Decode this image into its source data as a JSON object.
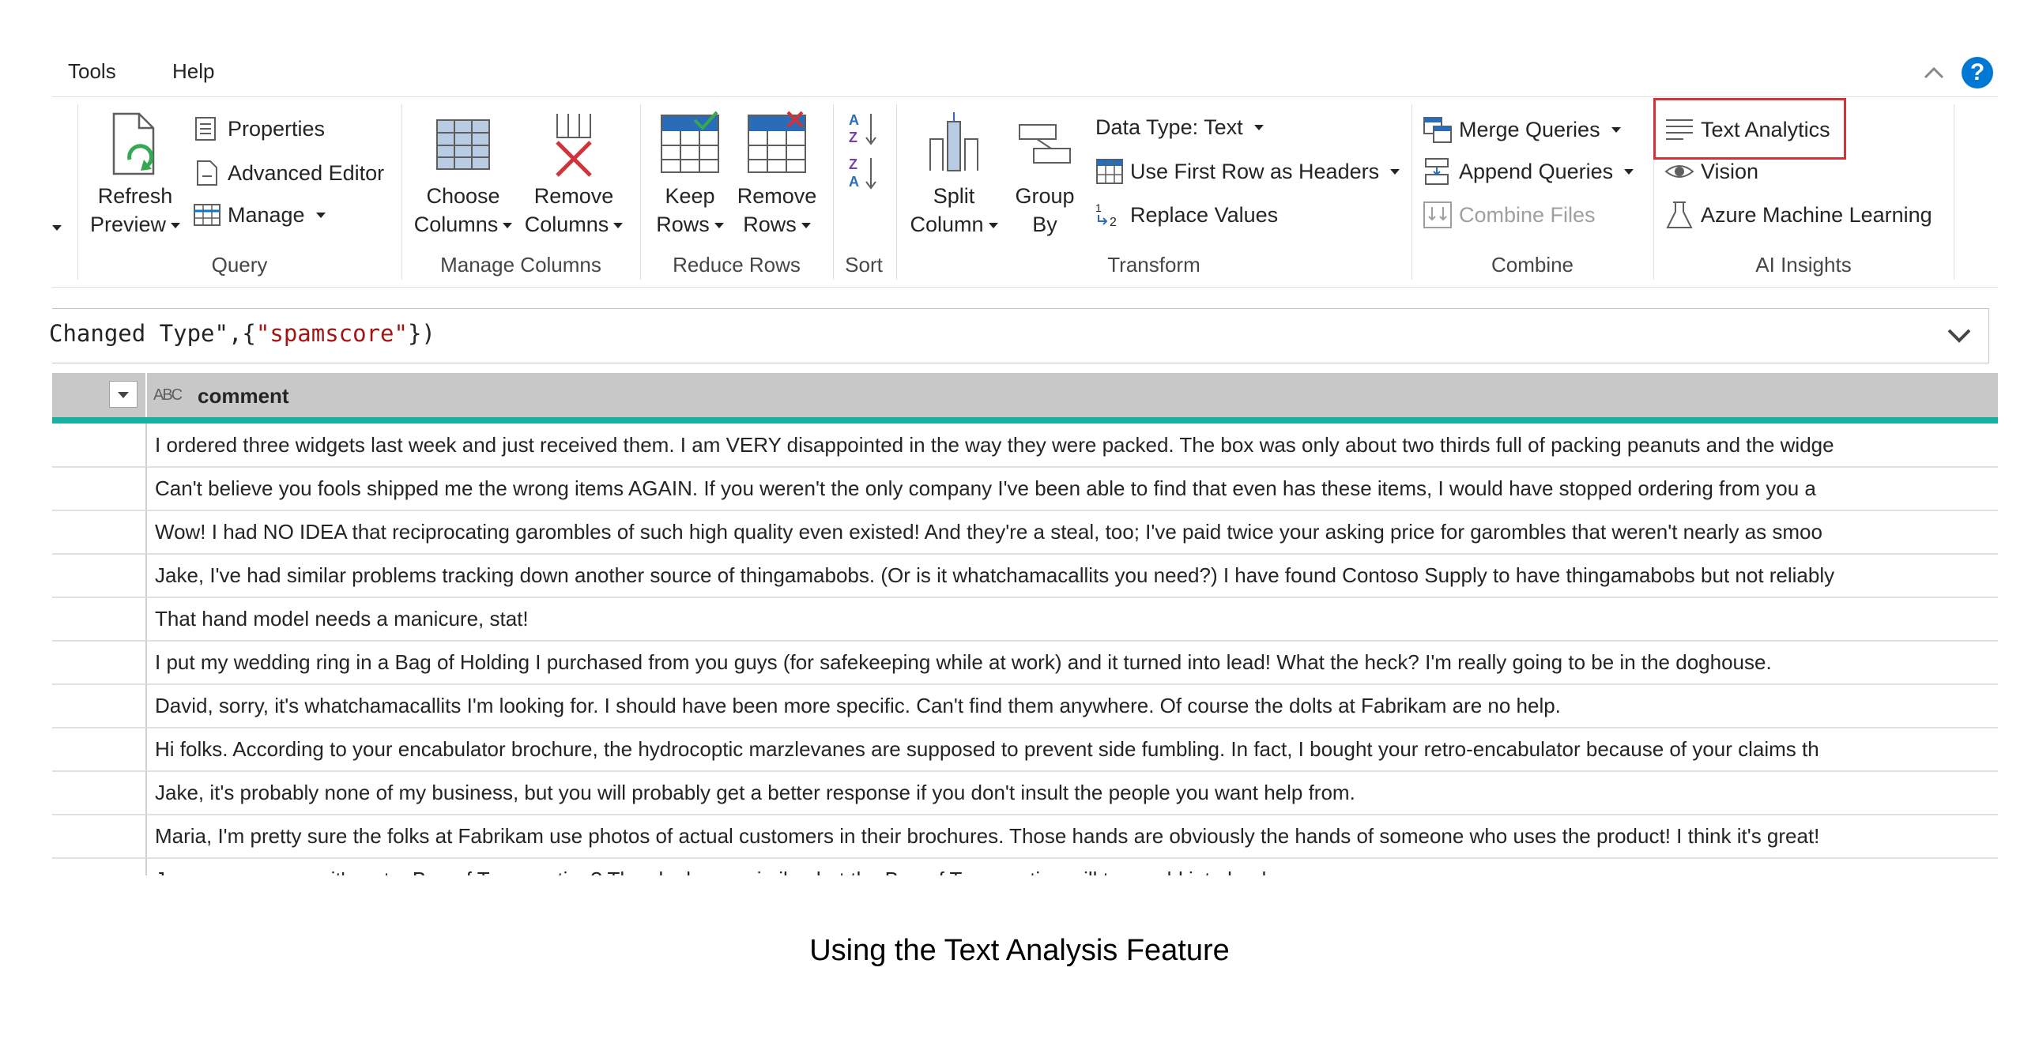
{
  "menu": {
    "tools_label": "Tools",
    "help_label": "Help"
  },
  "ribbon": {
    "query": {
      "refresh_line1": "Refresh",
      "refresh_line2": "Preview",
      "properties": "Properties",
      "advanced_editor": "Advanced Editor",
      "manage": "Manage",
      "group_label": "Query"
    },
    "manage_columns": {
      "choose_line1": "Choose",
      "choose_line2": "Columns",
      "remove_line1": "Remove",
      "remove_line2": "Columns",
      "group_label": "Manage Columns"
    },
    "reduce_rows": {
      "keep_line1": "Keep",
      "keep_line2": "Rows",
      "remove_line1": "Remove",
      "remove_line2": "Rows",
      "group_label": "Reduce Rows"
    },
    "sort": {
      "group_label": "Sort"
    },
    "transform": {
      "split_line1": "Split",
      "split_line2": "Column",
      "group_line1": "Group",
      "group_line2": "By",
      "data_type": "Data Type: Text",
      "use_first_row": "Use First Row as Headers",
      "replace_values": "Replace Values",
      "group_label": "Transform"
    },
    "combine": {
      "merge_queries": "Merge Queries",
      "append_queries": "Append Queries",
      "combine_files": "Combine Files",
      "group_label": "Combine"
    },
    "ai_insights": {
      "text_analytics": "Text Analytics",
      "vision": "Vision",
      "azure_ml": "Azure Machine Learning",
      "group_label": "AI Insights"
    },
    "highlight_color": "#d13438",
    "accent_color": "#0078d4"
  },
  "formula": {
    "prefix": "Changed Type\",{",
    "string": "\"spamscore\"",
    "suffix": "})"
  },
  "grid": {
    "column_header": "comment",
    "column_type_icon": "ABC",
    "header_color": "#c8c8c8",
    "teal_color": "#1ab0a0",
    "rows": [
      "I ordered three widgets last week and just received them. I am VERY disappointed in the way they were packed. The box was only about two thirds full of packing peanuts and the widge",
      "Can't believe you fools shipped me the wrong items AGAIN. If you weren't the only company I've been able to find that even has these items, I would have stopped ordering from you a",
      "Wow! I had NO IDEA that reciprocating garombles of such high quality even existed! And they're a steal, too; I've paid twice your asking price for garombles that weren't nearly as smoo",
      "Jake, I've had similar problems tracking down another source of thingamabobs. (Or is it whatchamacallits you need?) I have found Contoso Supply to have thingamabobs but not reliably",
      "That hand model needs a manicure, stat!",
      "I put my wedding ring in a Bag of Holding I purchased from you guys (for safekeeping while at work) and it turned into lead! What the heck? I'm really going to be in the doghouse.",
      "David, sorry, it's whatchamacallits I'm looking for. I should have been more specific. Can't find them anywhere. Of course the dolts at Fabrikam are no help.",
      "Hi folks. According to your encabulator brochure, the hydrocoptic marzlevanes are supposed to prevent side fumbling. In fact, I bought your retro-encabulator because of your claims th",
      "Jake, it's probably none of my business, but you will probably get a better response if you don't insult the people you want help from.",
      "Maria, I'm pretty sure the folks at Fabrikam use photos of actual customers in their brochures. Those hands are obviously the hands of someone who uses the product! I think it's great!",
      "Juan, are you sure it's not a Bag of Transmuting? They look very similar, but the Bag of Transmuting will turn gold into lead."
    ]
  },
  "caption": "Using the Text Analysis Feature"
}
